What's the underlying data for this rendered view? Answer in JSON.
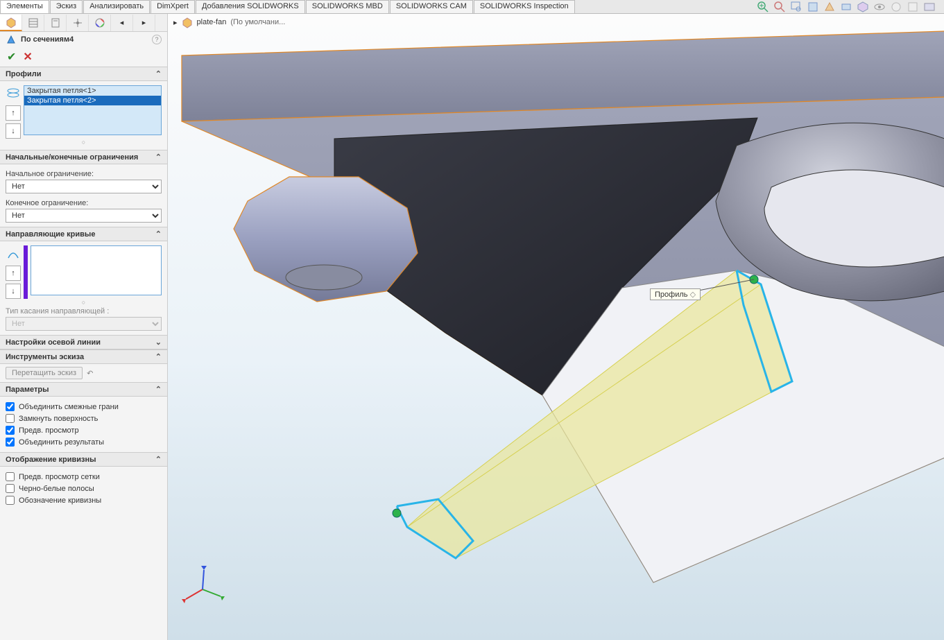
{
  "tabs": [
    "Элементы",
    "Эскиз",
    "Анализировать",
    "DimXpert",
    "Добавления SOLIDWORKS",
    "SOLIDWORKS MBD",
    "SOLIDWORKS CAM",
    "SOLIDWORKS Inspection"
  ],
  "active_tab": 0,
  "breadcrumb": {
    "part": "plate-fan",
    "config": "(По умолчани..."
  },
  "feature": {
    "title": "По сечениям4"
  },
  "sections": {
    "profiles": {
      "title": "Профили",
      "items": [
        "Закрытая петля<1>",
        "Закрытая петля<2>"
      ],
      "selected": 1
    },
    "constraints": {
      "title": "Начальные/конечные ограничения",
      "start_label": "Начальное ограничение:",
      "start_value": "Нет",
      "end_label": "Конечное ограничение:",
      "end_value": "Нет"
    },
    "guides": {
      "title": "Направляющие кривые",
      "tangency_label": "Тип касания направляющей :",
      "tangency_value": "Нет"
    },
    "centerline": {
      "title": "Настройки осевой линии"
    },
    "sketchtools": {
      "title": "Инструменты эскиза",
      "drag_label": "Перетащить эскиз"
    },
    "options": {
      "title": "Параметры",
      "merge_faces": {
        "label": "Объединить смежные грани",
        "checked": true
      },
      "close_surface": {
        "label": "Замкнуть поверхность",
        "checked": false
      },
      "preview": {
        "label": "Предв. просмотр",
        "checked": true
      },
      "merge_results": {
        "label": "Объединить результаты",
        "checked": true
      }
    },
    "curvature": {
      "title": "Отображение кривизны",
      "mesh_preview": {
        "label": "Предв. просмотр сетки",
        "checked": false
      },
      "zebra": {
        "label": "Черно-белые полосы",
        "checked": false
      },
      "curv_ind": {
        "label": "Обозначение кривизны",
        "checked": false
      }
    }
  },
  "viewport": {
    "tooltip": "Профиль"
  }
}
